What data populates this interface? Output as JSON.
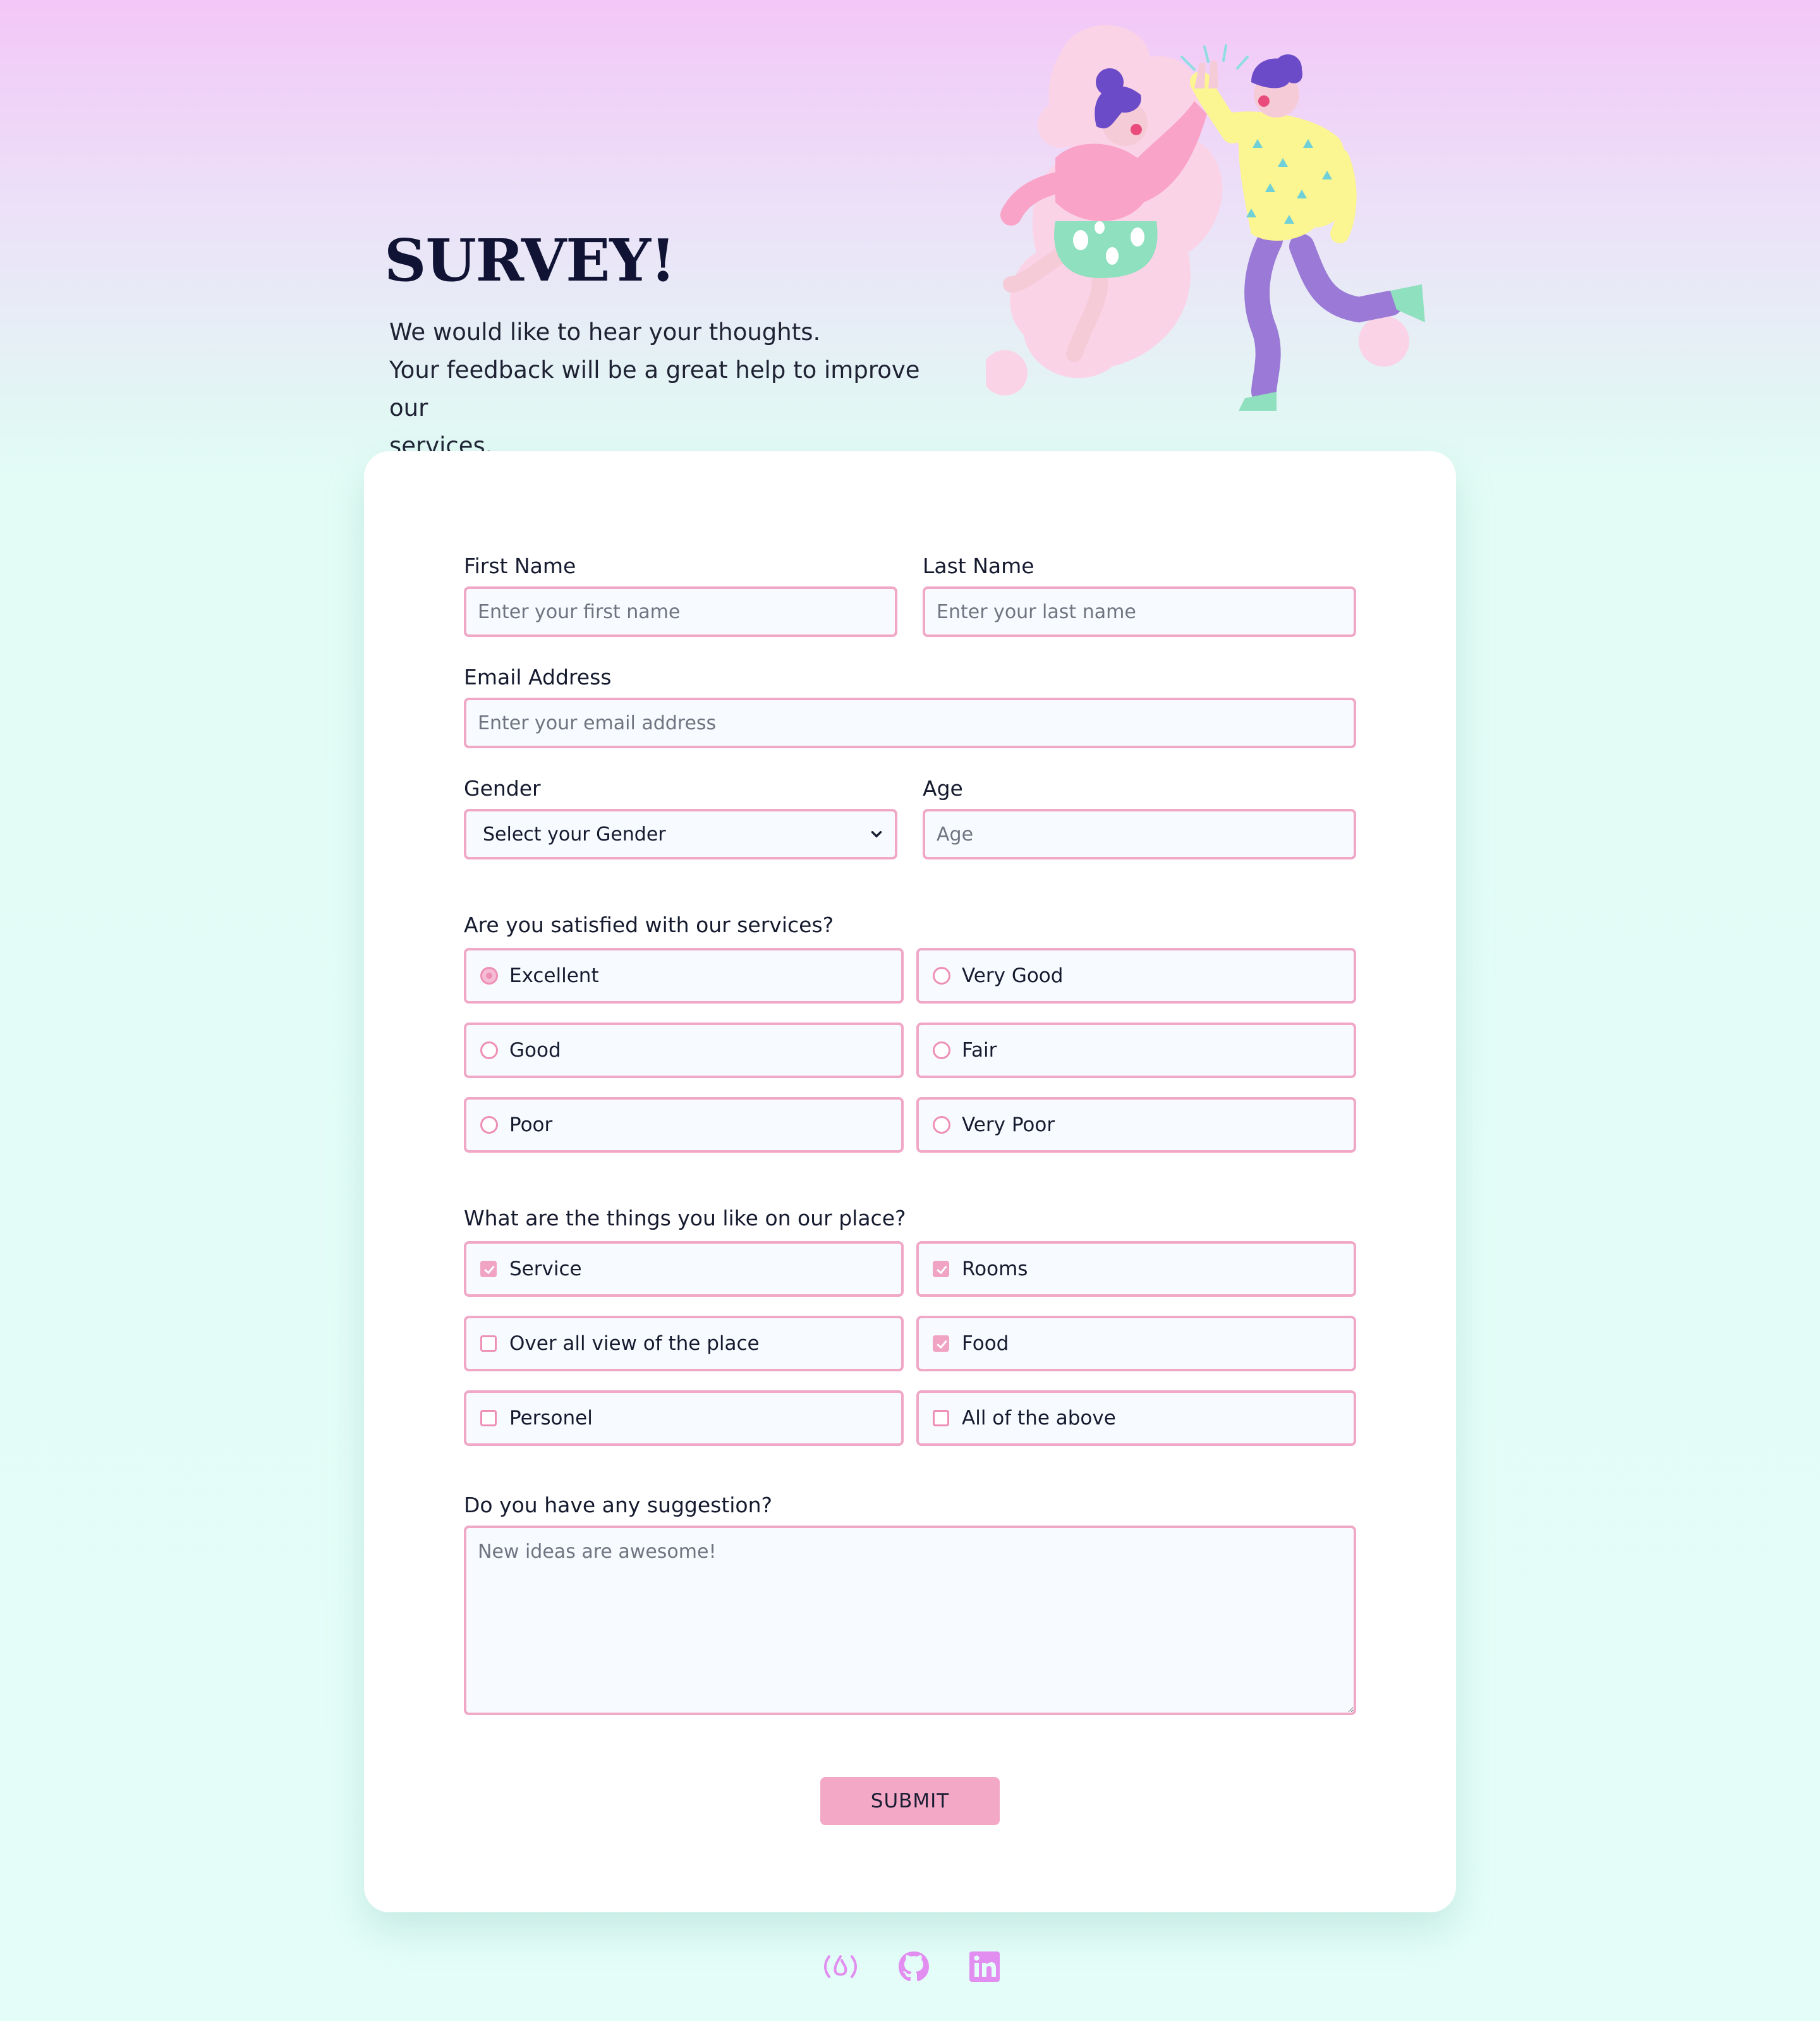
{
  "header": {
    "title": "SURVEY!",
    "intro_lines": [
      "We would like to hear your thoughts.",
      "Your feedback will be a great help to improve our",
      "services."
    ]
  },
  "form": {
    "first_name": {
      "label": "First Name",
      "placeholder": "Enter your first name",
      "value": ""
    },
    "last_name": {
      "label": "Last Name",
      "placeholder": "Enter your last name",
      "value": ""
    },
    "email": {
      "label": "Email Address",
      "placeholder": "Enter your email address",
      "value": ""
    },
    "gender": {
      "label": "Gender",
      "selected": "Select your Gender"
    },
    "age": {
      "label": "Age",
      "placeholder": "Age",
      "value": ""
    },
    "satisfaction": {
      "question": "Are you satisfied with our services?",
      "options": [
        {
          "label": "Excellent",
          "selected": true
        },
        {
          "label": "Very Good",
          "selected": false
        },
        {
          "label": "Good",
          "selected": false
        },
        {
          "label": "Fair",
          "selected": false
        },
        {
          "label": "Poor",
          "selected": false
        },
        {
          "label": "Very Poor",
          "selected": false
        }
      ]
    },
    "likes": {
      "question": "What are the things you like on our place?",
      "options": [
        {
          "label": "Service",
          "checked": true
        },
        {
          "label": "Rooms",
          "checked": true
        },
        {
          "label": "Over all view of the place",
          "checked": false
        },
        {
          "label": "Food",
          "checked": true
        },
        {
          "label": "Personel",
          "checked": false
        },
        {
          "label": "All of the above",
          "checked": false
        }
      ]
    },
    "suggestion": {
      "label": "Do you have any suggestion?",
      "placeholder": "New ideas are awesome!",
      "value": ""
    },
    "submit_label": "SUBMIT"
  },
  "footer": {
    "icons": [
      "freecodecamp-icon",
      "github-icon",
      "linkedin-icon"
    ]
  },
  "colors": {
    "accent_pink": "#f1a7c6",
    "submit_bg": "#f3a9c6",
    "field_bg": "#f7fbff",
    "footer_icon": "#e28df0",
    "title": "#101334"
  }
}
